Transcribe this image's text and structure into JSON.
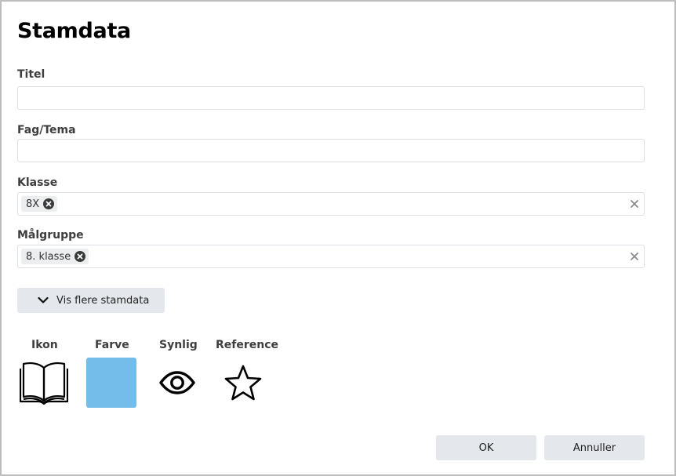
{
  "dialog": {
    "title": "Stamdata"
  },
  "fields": {
    "titel": {
      "label": "Titel",
      "value": ""
    },
    "fag": {
      "label": "Fag/Tema",
      "value": ""
    },
    "klasse": {
      "label": "Klasse",
      "chips": [
        "8X"
      ]
    },
    "maalgruppe": {
      "label": "Målgruppe",
      "chips": [
        "8. klasse"
      ]
    }
  },
  "more_button": {
    "label": "Vis flere stamdata",
    "icon": "chevron-down-icon"
  },
  "properties": {
    "ikon": {
      "label": "Ikon",
      "icon": "open-book-icon"
    },
    "farve": {
      "label": "Farve",
      "color": "#74bce9"
    },
    "synlig": {
      "label": "Synlig",
      "icon": "eye-icon"
    },
    "reference": {
      "label": "Reference",
      "icon": "star-outline-icon"
    }
  },
  "footer": {
    "ok_label": "OK",
    "cancel_label": "Annuller"
  }
}
